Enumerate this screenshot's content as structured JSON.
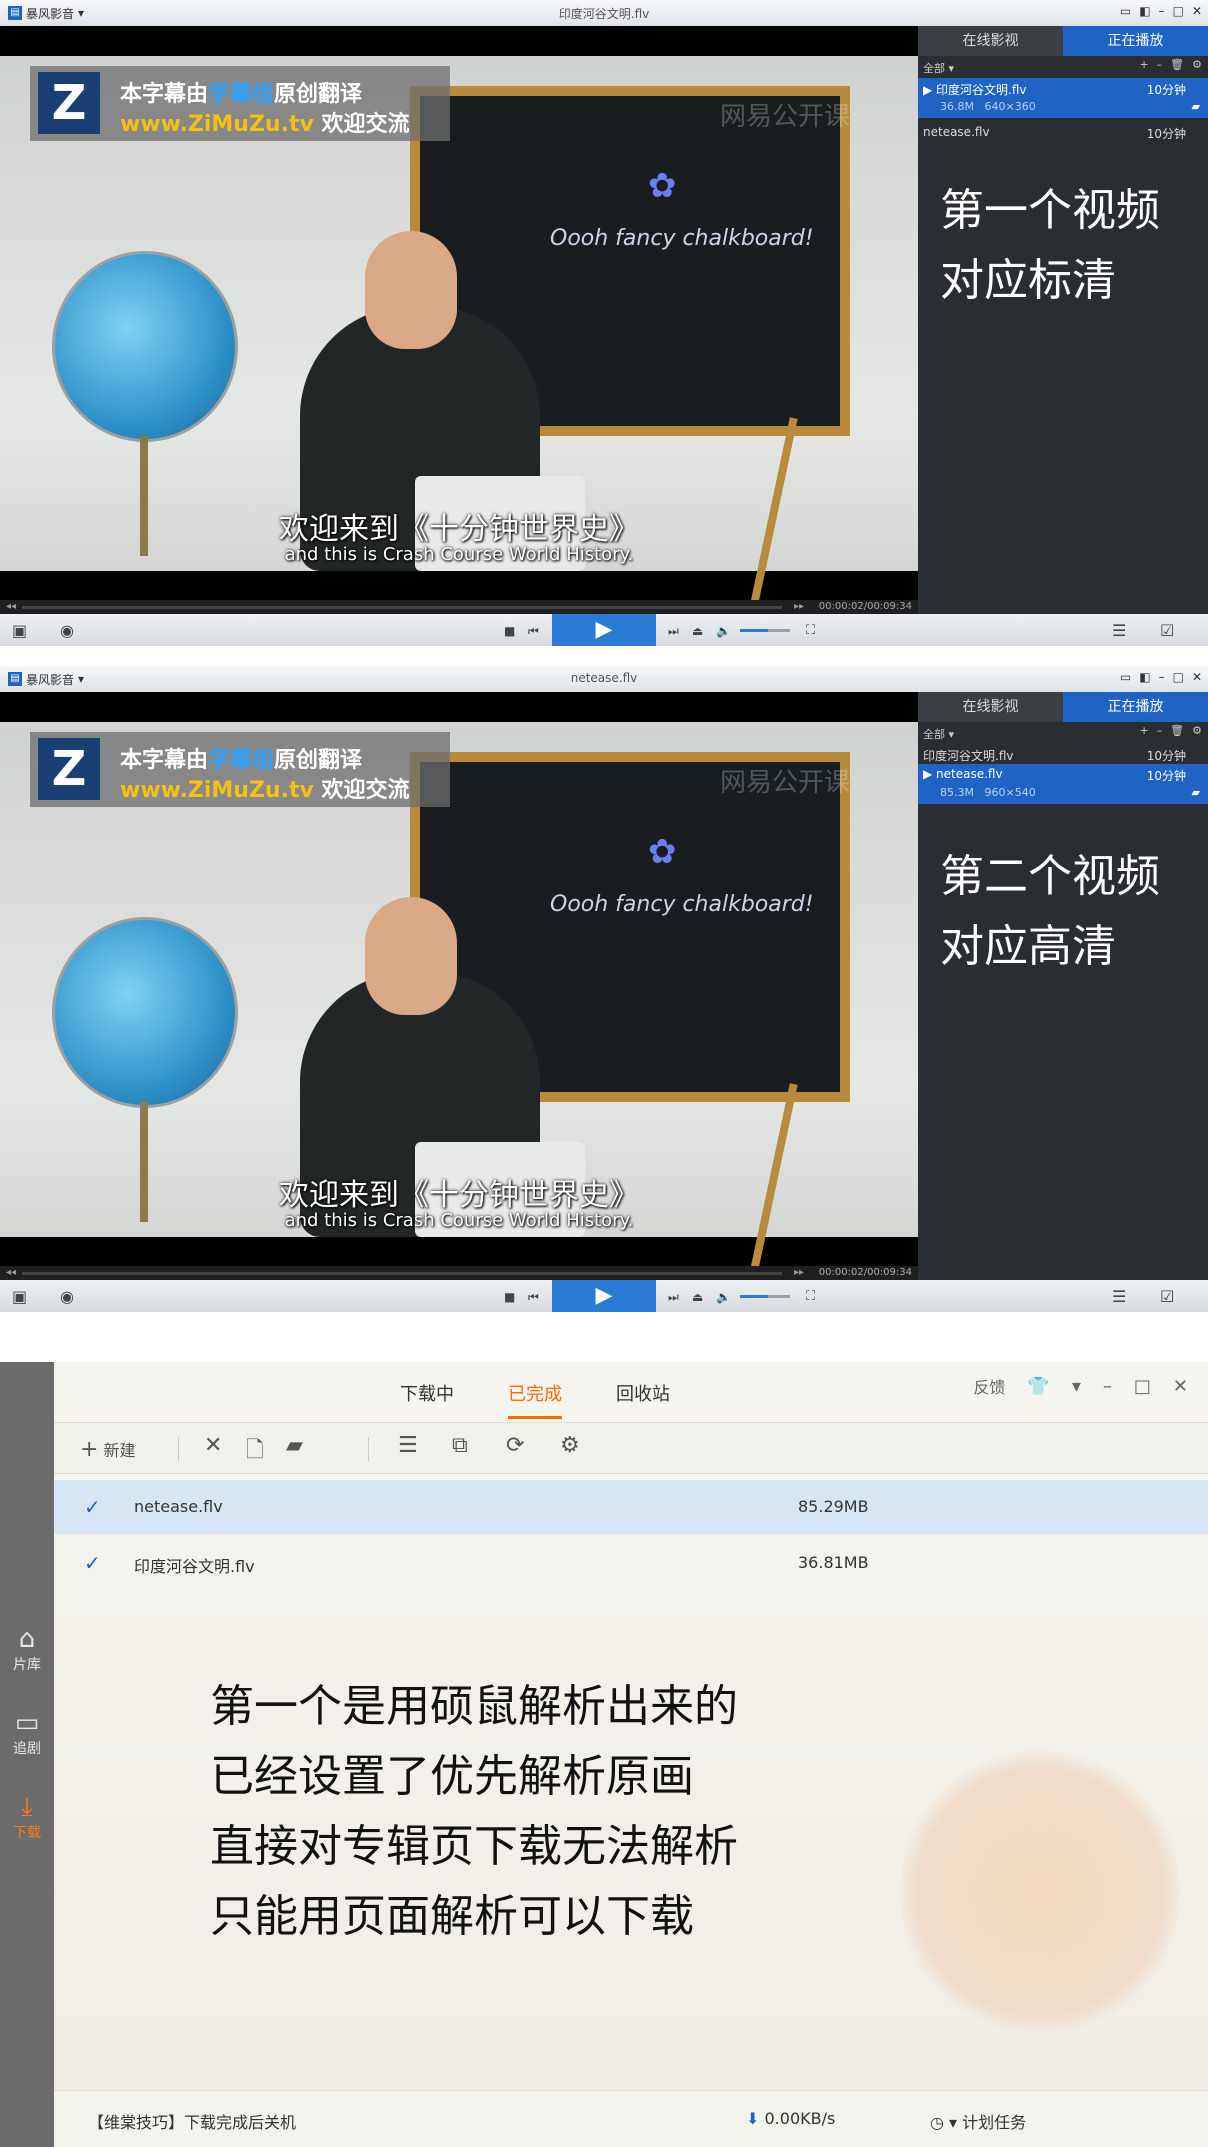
{
  "players": [
    {
      "app_name": "暴风影音",
      "window_title": "印度河谷文明.flv",
      "logo_text_line1_a": "本字幕由",
      "logo_text_line1_b": "字幕组",
      "logo_text_line1_c": "原创翻译",
      "logo_text_line2_a": "www.ZiMuZu.tv",
      "logo_text_line2_b": "欢迎交流",
      "chalk_text": "Oooh fancy chalkboard!",
      "watermark": "网易公开课",
      "subtitle_cn": "欢迎来到《十分钟世界史》",
      "subtitle_en": "and this is Crash Course World History.",
      "time": "00:00:02/00:09:34",
      "tabs": [
        "在线影视",
        "正在播放"
      ],
      "playlist_filter": "全部",
      "playlist": [
        {
          "name": "印度河谷文明.flv",
          "duration": "10分钟",
          "selected": true,
          "size": "36.8M",
          "resolution": "640×360"
        },
        {
          "name": "netease.flv",
          "duration": "10分钟",
          "selected": false
        }
      ],
      "note_lines": [
        "第一个视频",
        "对应标清"
      ]
    },
    {
      "app_name": "暴风影音",
      "window_title": "netease.flv",
      "logo_text_line1_a": "本字幕由",
      "logo_text_line1_b": "字幕组",
      "logo_text_line1_c": "原创翻译",
      "logo_text_line2_a": "www.ZiMuZu.tv",
      "logo_text_line2_b": "欢迎交流",
      "chalk_text": "Oooh fancy chalkboard!",
      "watermark": "网易公开课",
      "subtitle_cn": "欢迎来到《十分钟世界史》",
      "subtitle_en": "and this is Crash Course World History.",
      "time": "00:00:02/00:09:34",
      "tabs": [
        "在线影视",
        "正在播放"
      ],
      "playlist_filter": "全部",
      "playlist": [
        {
          "name": "印度河谷文明.flv",
          "duration": "10分钟",
          "selected": false
        },
        {
          "name": "netease.flv",
          "duration": "10分钟",
          "selected": true,
          "size": "85.3M",
          "resolution": "960×540"
        }
      ],
      "note_lines": [
        "第二个视频",
        "对应高清"
      ]
    }
  ],
  "downloader": {
    "tabs": [
      "下载中",
      "已完成",
      "回收站"
    ],
    "active_tab": "已完成",
    "feedback": "反馈",
    "toolbar_new": "新建",
    "side_nav": [
      "片库",
      "追剧",
      "下载"
    ],
    "files": [
      {
        "name": "netease.flv",
        "size": "85.29MB",
        "selected": true
      },
      {
        "name": "印度河谷文明.flv",
        "size": "36.81MB",
        "selected": false
      }
    ],
    "note_lines": [
      "第一个是用硕鼠解析出来的",
      "已经设置了优先解析原画",
      "直接对专辑页下载无法解析",
      "只能用页面解析可以下载"
    ],
    "status_tip": "【维棠技巧】下载完成后关机",
    "speed": "0.00KB/s",
    "plan": "计划任务"
  },
  "colors": {
    "accent_blue": "#1f64c4",
    "download_orange": "#ff6a00"
  },
  "icons": [
    "monitor-icon",
    "skin-icon",
    "minimize-icon",
    "maximize-icon",
    "close-icon",
    "toolbox-icon",
    "eye-icon",
    "stop-icon",
    "prev-icon",
    "play-icon",
    "next-icon",
    "eject-icon",
    "volume-icon",
    "fullscreen-icon",
    "playlist-icon",
    "settings-icon",
    "add-icon",
    "delete-icon",
    "folder-icon",
    "shirt-icon",
    "check-icon",
    "download-arrow-icon",
    "clock-icon"
  ]
}
